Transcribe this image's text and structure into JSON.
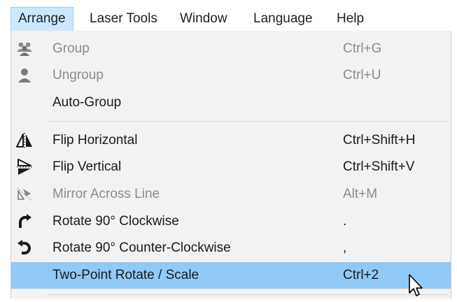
{
  "menubar": {
    "items": [
      {
        "label": "Arrange",
        "active": true
      },
      {
        "label": "Laser Tools",
        "active": false
      },
      {
        "label": "Window",
        "active": false
      },
      {
        "label": "Language",
        "active": false
      },
      {
        "label": "Help",
        "active": false
      }
    ]
  },
  "dropdown": {
    "items": [
      {
        "label": "Group",
        "shortcut": "Ctrl+G",
        "icon": "group-icon",
        "enabled": false
      },
      {
        "label": "Ungroup",
        "shortcut": "Ctrl+U",
        "icon": "ungroup-icon",
        "enabled": false
      },
      {
        "label": "Auto-Group",
        "shortcut": "",
        "icon": "",
        "enabled": true
      },
      {
        "label": "Flip Horizontal",
        "shortcut": "Ctrl+Shift+H",
        "icon": "flip-horizontal-icon",
        "enabled": true
      },
      {
        "label": "Flip Vertical",
        "shortcut": "Ctrl+Shift+V",
        "icon": "flip-vertical-icon",
        "enabled": true
      },
      {
        "label": "Mirror Across Line",
        "shortcut": "Alt+M",
        "icon": "mirror-across-line-icon",
        "enabled": false
      },
      {
        "label": "Rotate 90° Clockwise",
        "shortcut": ".",
        "icon": "rotate-clockwise-icon",
        "enabled": true
      },
      {
        "label": "Rotate 90° Counter-Clockwise",
        "shortcut": ",",
        "icon": "rotate-counter-clockwise-icon",
        "enabled": true
      },
      {
        "label": "Two-Point Rotate / Scale",
        "shortcut": "Ctrl+2",
        "icon": "",
        "enabled": true,
        "highlighted": true
      }
    ]
  },
  "colors": {
    "active_menu_bg": "#cce8ff",
    "highlight_row_bg": "#91c9f7",
    "dropdown_bg": "#f2f2f2",
    "disabled_text": "#8c8c8c"
  },
  "pointer": {
    "icon": "mouse-cursor-icon"
  }
}
